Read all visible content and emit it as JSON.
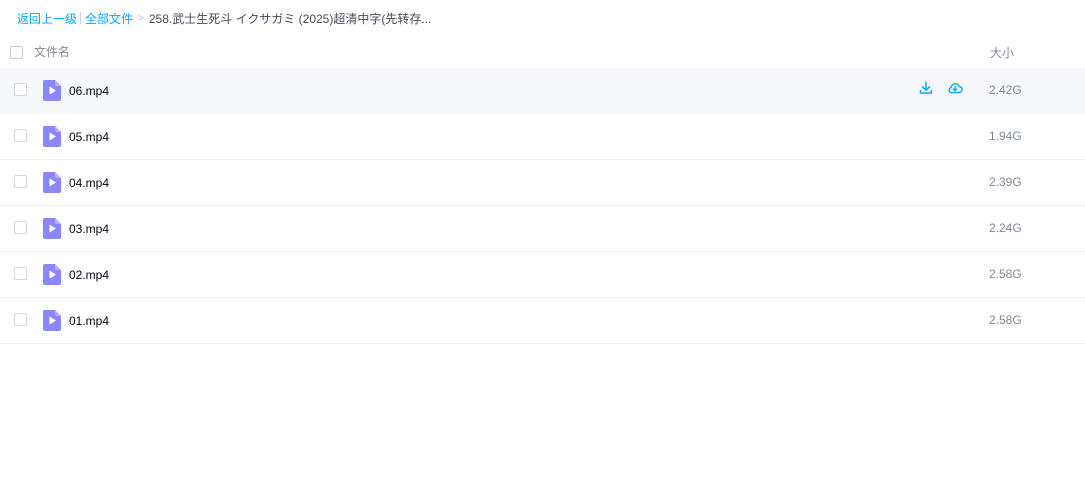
{
  "breadcrumb": {
    "back": "返回上一级",
    "all_files": "全部文件",
    "separator": ">",
    "current": "258.武士生死斗 イクサガミ (2025)超清中字(先转存..."
  },
  "header": {
    "name_col": "文件名",
    "size_col": "大小"
  },
  "files": [
    {
      "name": "06.mp4",
      "size": "2.42G",
      "icon": "video-file-icon"
    },
    {
      "name": "05.mp4",
      "size": "1.94G",
      "icon": "video-file-icon"
    },
    {
      "name": "04.mp4",
      "size": "2.39G",
      "icon": "video-file-icon"
    },
    {
      "name": "03.mp4",
      "size": "2.24G",
      "icon": "video-file-icon"
    },
    {
      "name": "02.mp4",
      "size": "2.58G",
      "icon": "video-file-icon"
    },
    {
      "name": "01.mp4",
      "size": "2.58G",
      "icon": "video-file-icon"
    }
  ],
  "row_actions": {
    "download_icon": "download-icon",
    "cloud_icon": "cloud-save-icon"
  },
  "colors": {
    "accent": "#06a7ff",
    "video_icon": "#8a87ff"
  }
}
